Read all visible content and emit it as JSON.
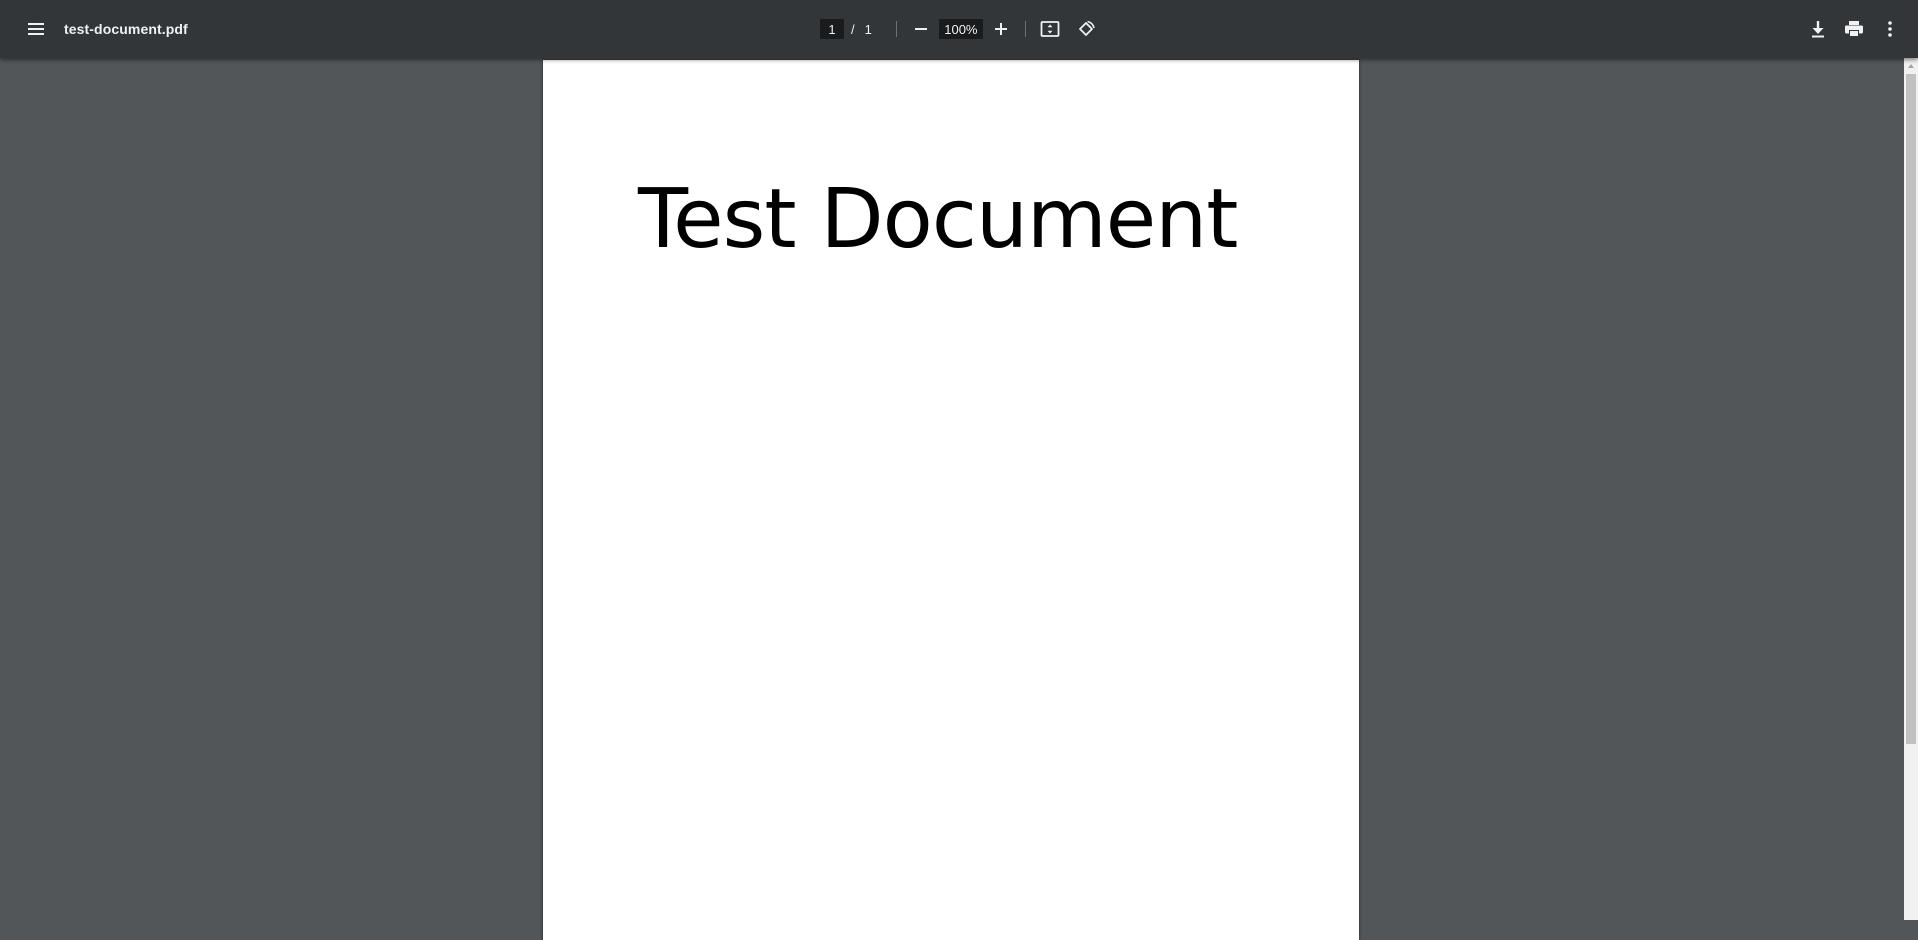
{
  "toolbar": {
    "menu_icon": "hamburger-menu-icon",
    "title": "test-document.pdf",
    "page_current": "1",
    "page_separator": "/",
    "page_total": "1",
    "zoom_out_icon": "minus-icon",
    "zoom_value": "100%",
    "zoom_in_icon": "plus-icon",
    "fit_icon": "fit-to-page-icon",
    "rotate_icon": "rotate-counterclockwise-icon",
    "download_icon": "download-icon",
    "print_icon": "print-icon",
    "more_icon": "more-vertical-icon"
  },
  "document": {
    "heading": "Test Document"
  },
  "colors": {
    "toolbar_bg": "#323639",
    "viewer_bg": "#525659",
    "page_bg": "#ffffff",
    "icon_color": "#f1f1f1"
  }
}
